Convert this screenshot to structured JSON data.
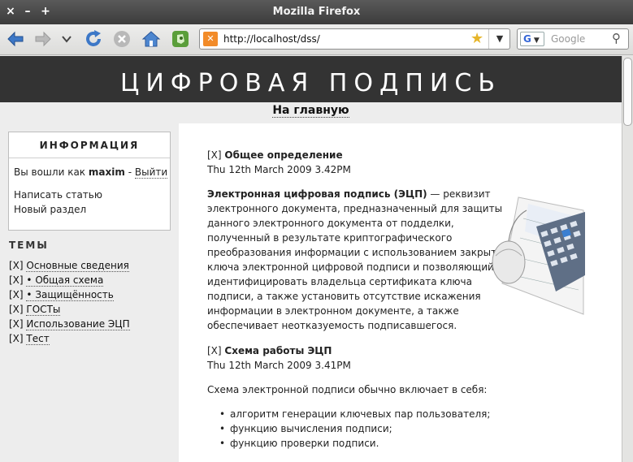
{
  "window": {
    "title": "Mozilla Firefox",
    "close": "×",
    "minimize": "–",
    "maximize": "+"
  },
  "toolbar": {
    "url": "http://localhost/dss/",
    "search_placeholder": "Google",
    "search_engine": "G"
  },
  "page": {
    "site_title": "ЦИФРОВАЯ ПОДПИСЬ",
    "home_link": "На главную",
    "info": {
      "heading": "ИНФОРМАЦИЯ",
      "logged_in_prefix": "Вы вошли как",
      "username": "maxim",
      "separator": "-",
      "logout": "Выйти",
      "write_article": "Написать статью",
      "new_section": "Новый раздел"
    },
    "topics": {
      "heading": "ТЕМЫ",
      "items": [
        {
          "marker": "[X]",
          "label": "Основные сведения"
        },
        {
          "marker": "[X]",
          "label": "• Общая схема"
        },
        {
          "marker": "[X]",
          "label": "• Защищённость"
        },
        {
          "marker": "[X]",
          "label": "ГОСТы"
        },
        {
          "marker": "[X]",
          "label": "Использование ЭЦП"
        },
        {
          "marker": "[X]",
          "label": "Тест"
        }
      ]
    },
    "articles": [
      {
        "marker": "[X]",
        "title": "Общее определение",
        "date": "Thu 12th March 2009 3.42PM",
        "lead_bold": "Электронная цифровая подпись (ЭЦП)",
        "body_lines": [
          " — реквизит",
          "электронного документа, предназначенный для защиты",
          "данного электронного документа от подделки,",
          "полученный в результате криптографического",
          "преобразования информации с использованием закрытого",
          "ключа электронной цифровой подписи и позволяющий",
          "идентифицировать владельца сертификата ключа",
          "подписи, а также установить отсутствие искажения",
          "информации в электронном документе, а также",
          "обеспечивает неотказуемость подписавшегося."
        ]
      },
      {
        "marker": "[X]",
        "title": "Схема работы ЭЦП",
        "date": "Thu 12th March 2009 3.41PM",
        "intro": "Схема электронной подписи обычно включает в себя:",
        "bullets": [
          "алгоритм генерации ключевых пар пользователя;",
          "функцию вычисления подписи;",
          "функцию проверки подписи."
        ]
      }
    ]
  }
}
